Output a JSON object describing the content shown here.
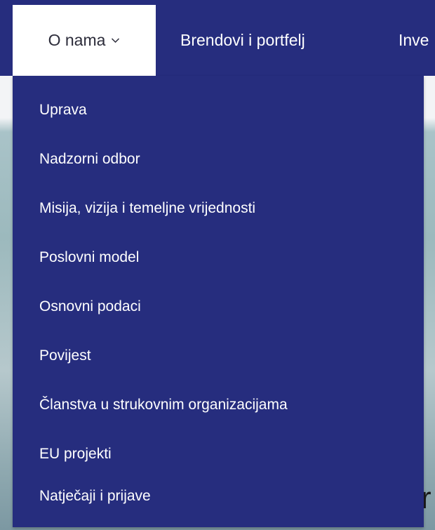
{
  "navbar": {
    "active_item": {
      "label": "O nama"
    },
    "items": [
      {
        "label": "Brendovi i portfelj"
      },
      {
        "label": "Inve"
      }
    ]
  },
  "dropdown": {
    "items": [
      {
        "label": "Uprava"
      },
      {
        "label": "Nadzorni odbor"
      },
      {
        "label": "Misija, vizija i temeljne vrijednosti"
      },
      {
        "label": "Poslovni model"
      },
      {
        "label": "Osnovni podaci"
      },
      {
        "label": "Povijest"
      },
      {
        "label": "Članstva u strukovnim organizacijama"
      },
      {
        "label": "EU projekti"
      },
      {
        "label": "Natječaji i prijave"
      }
    ]
  },
  "hero": {
    "partial_text": "r"
  },
  "colors": {
    "nav_bg": "#262d7e",
    "active_tab_bg": "#ffffff",
    "text_light": "#ffffff",
    "text_dark": "#2c2c3a"
  },
  "icons": {
    "active_tab_chevron": "chevron-down-icon"
  }
}
